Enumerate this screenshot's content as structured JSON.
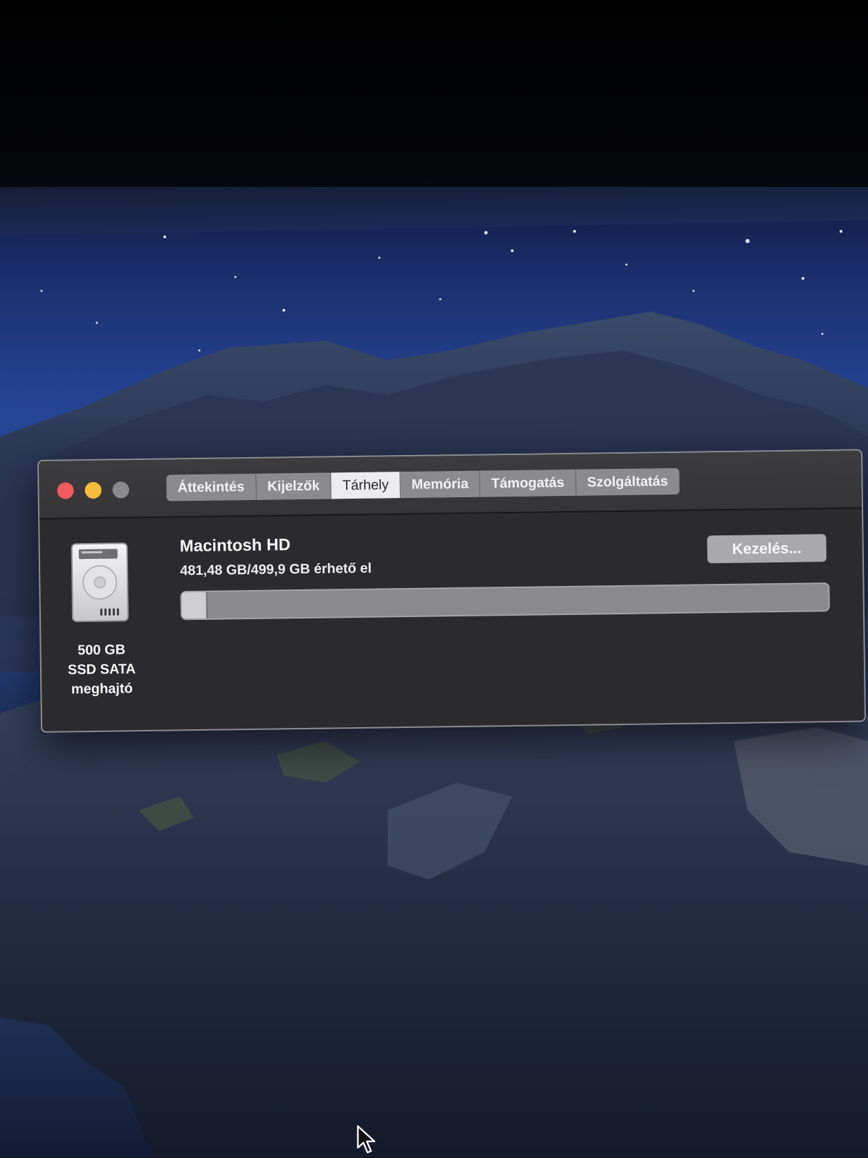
{
  "window": {
    "tabs": [
      {
        "label": "Áttekintés",
        "selected": false
      },
      {
        "label": "Kijelzők",
        "selected": false
      },
      {
        "label": "Tárhely",
        "selected": true
      },
      {
        "label": "Memória",
        "selected": false
      },
      {
        "label": "Támogatás",
        "selected": false
      },
      {
        "label": "Szolgáltatás",
        "selected": false
      }
    ],
    "traffic_lights": {
      "close_color": "#f25a5d",
      "minimize_color": "#f6bd3c",
      "zoom_color": "#8a8a8c"
    }
  },
  "drive": {
    "icon": "hard-drive-icon",
    "capacity": "500 GB",
    "type": "SSD SATA",
    "kind": "meghajtó"
  },
  "volume": {
    "name": "Macintosh HD",
    "space_text": "481,48 GB/499,9 GB érhető el",
    "used_fraction": 0.037,
    "manage_label": "Kezelés..."
  },
  "desktop": {
    "wallpaper": "night island wallpaper",
    "cursor_icon": "mouse-pointer-icon"
  }
}
